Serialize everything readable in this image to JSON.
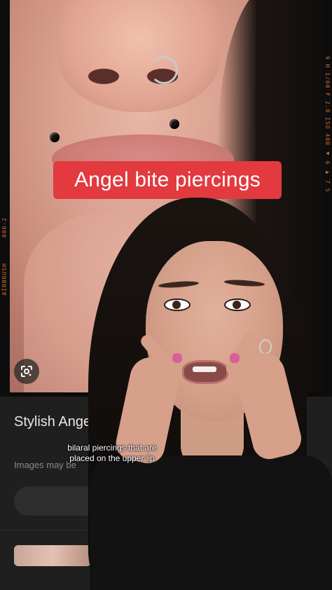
{
  "overlay": {
    "banner_text": "Angel bite piercings",
    "subtitle_text": "bilaral piercings that are placed on the upper lip"
  },
  "search_card": {
    "title_visible": "Stylish Ange Inspiration",
    "subtext_visible": "Images may be"
  },
  "film_edge": {
    "left_top": "800-2",
    "left_bottom": "AIRBRUSH",
    "right": "9 H 1/60 F 2.8 ISO 400 ◀ 6 ▶ 7 5"
  },
  "colors": {
    "banner_bg": "#e23a3f",
    "banner_text": "#ffffff",
    "card_bg": "#1f1f1f",
    "edge_text": "#d46a2a"
  },
  "icons": {
    "lens": "google-lens-icon"
  }
}
